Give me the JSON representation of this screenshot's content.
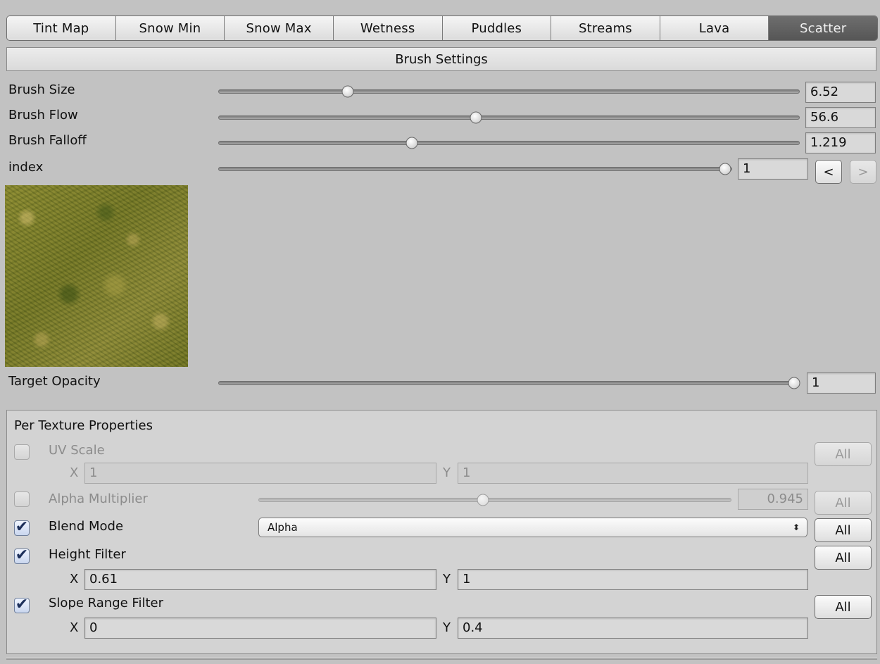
{
  "tabs": [
    {
      "label": "Tint Map"
    },
    {
      "label": "Snow Min"
    },
    {
      "label": "Snow Max"
    },
    {
      "label": "Wetness"
    },
    {
      "label": "Puddles"
    },
    {
      "label": "Streams"
    },
    {
      "label": "Lava"
    },
    {
      "label": "Scatter",
      "active": true
    }
  ],
  "brush": {
    "header": "Brush Settings",
    "size": {
      "label": "Brush Size",
      "value": "6.52"
    },
    "flow": {
      "label": "Brush Flow",
      "value": "56.6"
    },
    "falloff": {
      "label": "Brush Falloff",
      "value": "1.219"
    },
    "index": {
      "label": "index",
      "value": "1",
      "prev": "<",
      "next": ">"
    },
    "target_opacity": {
      "label": "Target Opacity",
      "value": "1"
    }
  },
  "per_texture": {
    "title": "Per Texture Properties",
    "uv_scale": {
      "label": "UV Scale",
      "x_label": "X",
      "x": "1",
      "y_label": "Y",
      "y": "1",
      "all": "All",
      "enabled": false
    },
    "alpha_multiplier": {
      "label": "Alpha Multiplier",
      "value": "0.945",
      "all": "All",
      "enabled": false
    },
    "blend_mode": {
      "label": "Blend Mode",
      "value": "Alpha",
      "all": "All",
      "enabled": true
    },
    "height_filter": {
      "label": "Height Filter",
      "x_label": "X",
      "x": "0.61",
      "y_label": "Y",
      "y": "1",
      "all": "All",
      "enabled": true
    },
    "slope_range_filter": {
      "label": "Slope Range Filter",
      "x_label": "X",
      "x": "0",
      "y_label": "Y",
      "y": "0.4",
      "all": "All",
      "enabled": true
    }
  },
  "icons": {
    "check": "✔",
    "select_arrows": "⬍"
  }
}
